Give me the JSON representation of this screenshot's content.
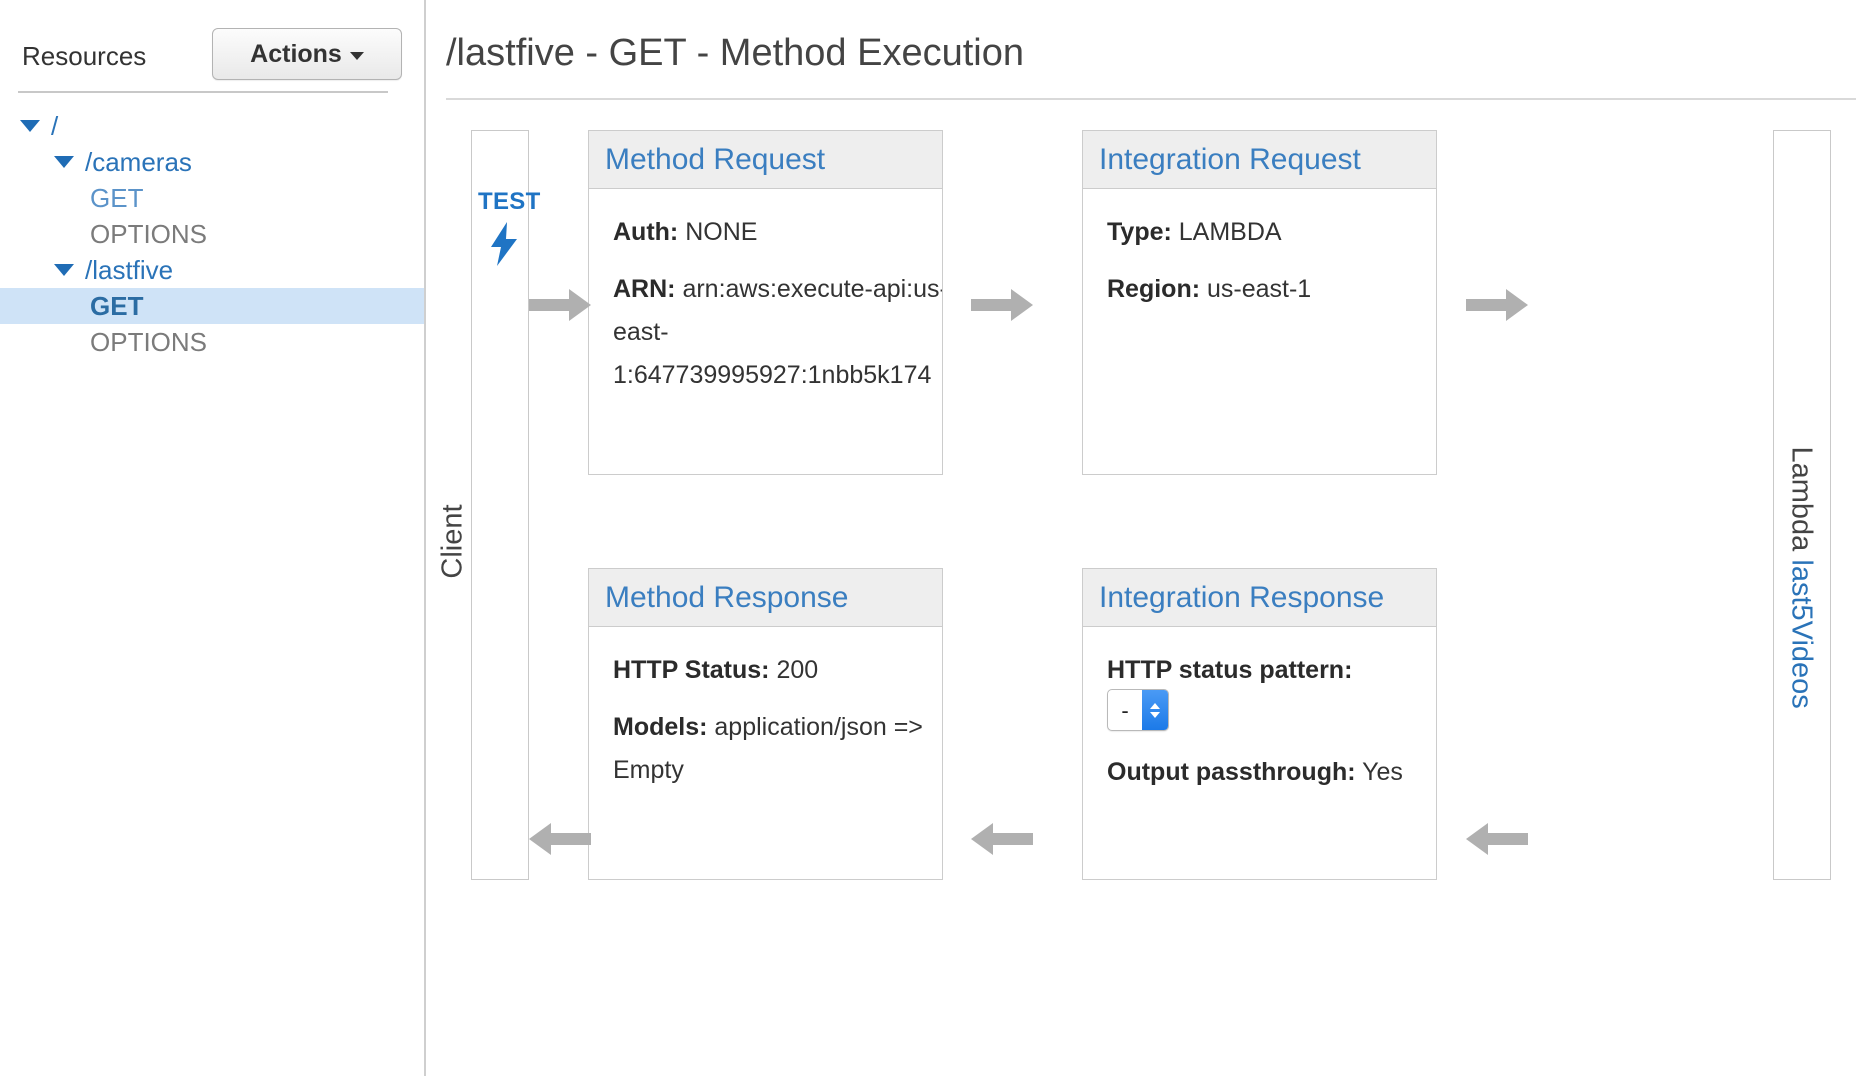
{
  "sidebar": {
    "title": "Resources",
    "actions_button": "Actions",
    "tree": [
      {
        "label": "/",
        "level": 0,
        "expandable": true,
        "style": "blue",
        "selected": false
      },
      {
        "label": "/cameras",
        "level": 1,
        "expandable": true,
        "style": "blue",
        "selected": false
      },
      {
        "label": "GET",
        "level": 2,
        "expandable": false,
        "style": "blue-light",
        "selected": false
      },
      {
        "label": "OPTIONS",
        "level": 2,
        "expandable": false,
        "style": "gray",
        "selected": false
      },
      {
        "label": "/lastfive",
        "level": 1,
        "expandable": true,
        "style": "blue",
        "selected": false
      },
      {
        "label": "GET",
        "level": 2,
        "expandable": false,
        "style": "bold-blue",
        "selected": true
      },
      {
        "label": "OPTIONS",
        "level": 2,
        "expandable": false,
        "style": "gray",
        "selected": false
      }
    ]
  },
  "main": {
    "page_title": "/lastfive - GET - Method Execution"
  },
  "diagram": {
    "client": {
      "test_link": "TEST",
      "bolt_icon": "lightning-bolt-icon",
      "label": "Client"
    },
    "lambda": {
      "kind": "Lambda",
      "function_name": "last5Videos"
    },
    "method_request": {
      "title": "Method Request",
      "auth_label": "Auth:",
      "auth_value": "NONE",
      "arn_label": "ARN:",
      "arn_value": "arn:aws:execute-api:us-east-1:647739995927:1nbb5k174"
    },
    "integration_request": {
      "title": "Integration Request",
      "type_label": "Type:",
      "type_value": "LAMBDA",
      "region_label": "Region:",
      "region_value": "us-east-1"
    },
    "method_response": {
      "title": "Method Response",
      "status_label": "HTTP Status:",
      "status_value": "200",
      "models_label": "Models:",
      "models_value": "application/json => Empty"
    },
    "integration_response": {
      "title": "Integration Response",
      "pattern_label": "HTTP status pattern:",
      "pattern_value": "-",
      "passthrough_label": "Output passthrough:",
      "passthrough_value": "Yes"
    },
    "arrows": [
      {
        "name": "arrow-client-to-method-request",
        "direction": "right"
      },
      {
        "name": "arrow-method-request-to-integration-request",
        "direction": "right"
      },
      {
        "name": "arrow-integration-request-to-lambda",
        "direction": "right"
      },
      {
        "name": "arrow-method-response-to-client",
        "direction": "left"
      },
      {
        "name": "arrow-integration-response-to-method-response",
        "direction": "left"
      },
      {
        "name": "arrow-lambda-to-integration-response",
        "direction": "left"
      }
    ]
  },
  "colors": {
    "link_blue": "#2a73b8",
    "header_blue": "#3a7ec0",
    "selected_row_bg": "#cfe3f7",
    "arrow_gray": "#b0b0b0",
    "box_header_bg": "#eeeeee",
    "stepper_blue": "#1c7ae8"
  }
}
